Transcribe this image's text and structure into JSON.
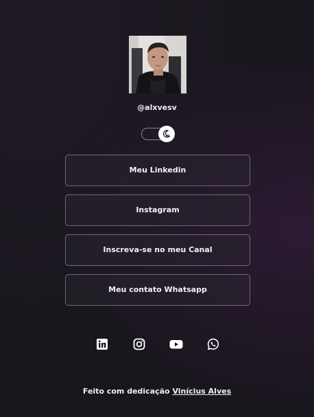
{
  "profile": {
    "handle": "@alxvesv"
  },
  "theme_toggle": {
    "icon": "moon-icon",
    "state": "dark"
  },
  "links": [
    {
      "label": "Meu Linkedin"
    },
    {
      "label": "Instagram"
    },
    {
      "label": "Inscreva-se no meu Canal"
    },
    {
      "label": "Meu contato Whatsapp"
    }
  ],
  "social": [
    {
      "icon": "linkedin-icon"
    },
    {
      "icon": "instagram-icon"
    },
    {
      "icon": "youtube-icon"
    },
    {
      "icon": "whatsapp-icon"
    }
  ],
  "footer": {
    "text": "Feito com dedicação",
    "author": "Vinícius Alves"
  },
  "colors": {
    "background": "#19161d",
    "button_border": "#6f6b76",
    "text": "#f2f2f2"
  }
}
